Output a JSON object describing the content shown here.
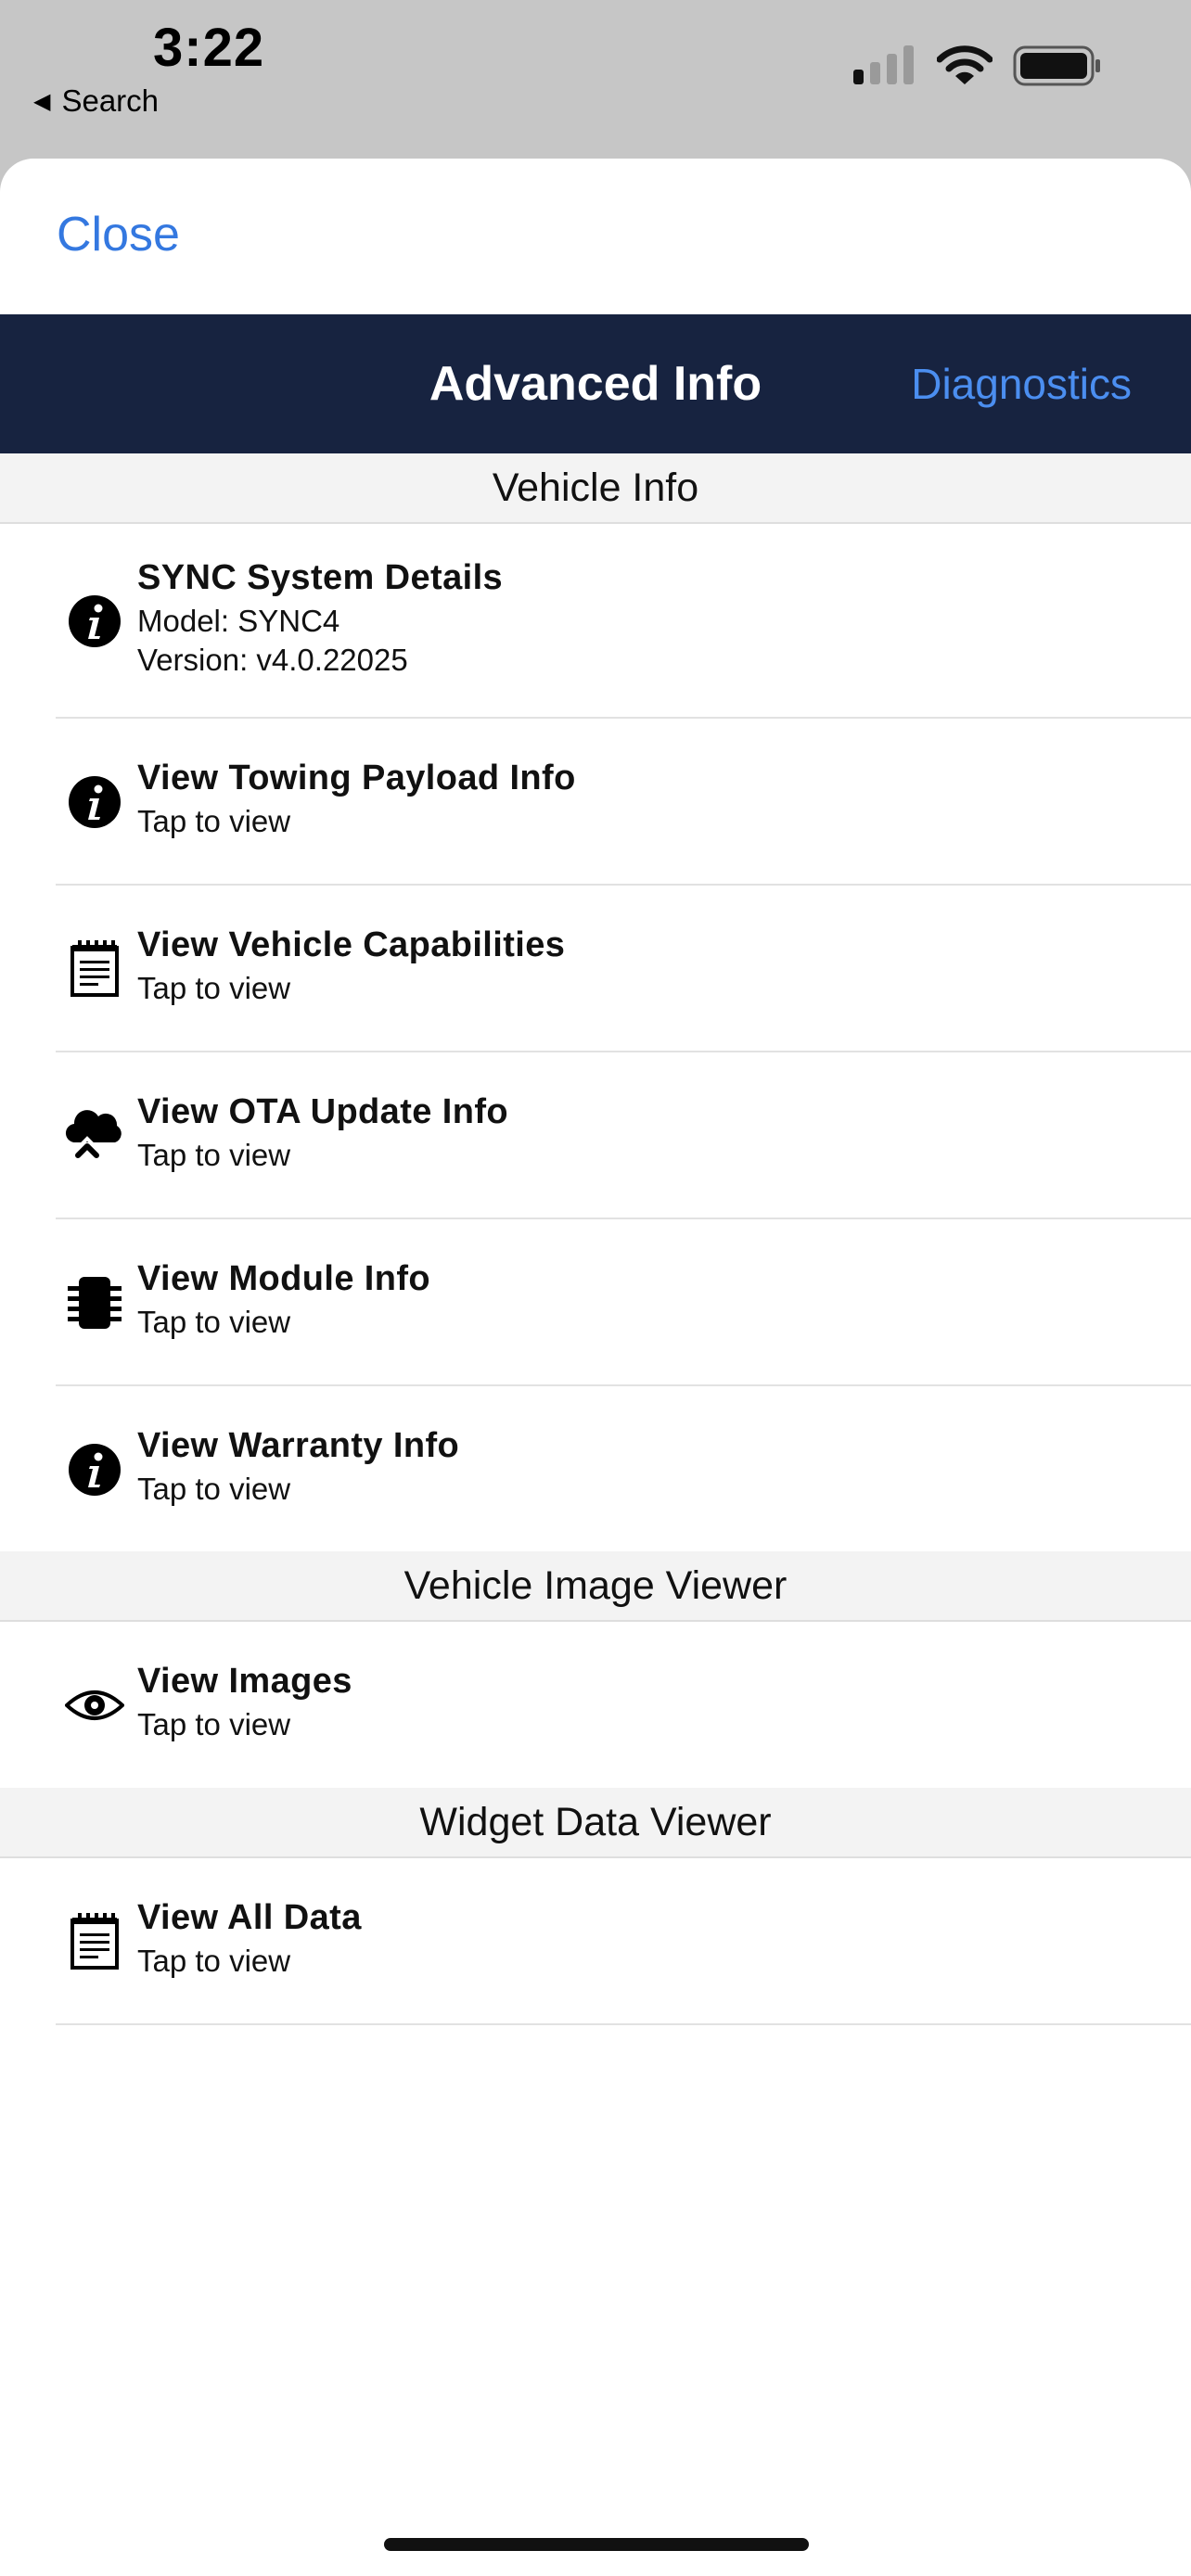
{
  "status_bar": {
    "time": "3:22",
    "back_label": "Search"
  },
  "sheet": {
    "close_label": "Close"
  },
  "nav": {
    "title": "Advanced Info",
    "right_label": "Diagnostics"
  },
  "sections": [
    {
      "header": "Vehicle Info",
      "rows": [
        {
          "icon": "info-icon",
          "title": "SYNC System Details",
          "lines": [
            "Model: SYNC4",
            "Version: v4.0.22025"
          ]
        },
        {
          "icon": "info-icon",
          "title": "View Towing Payload Info",
          "lines": [
            "Tap to view"
          ]
        },
        {
          "icon": "notepad-icon",
          "title": "View Vehicle Capabilities",
          "lines": [
            "Tap to view"
          ]
        },
        {
          "icon": "cloud-upload-icon",
          "title": "View OTA Update Info",
          "lines": [
            "Tap to view"
          ]
        },
        {
          "icon": "chip-icon",
          "title": "View Module Info",
          "lines": [
            "Tap to view"
          ]
        },
        {
          "icon": "info-icon",
          "title": "View Warranty Info",
          "lines": [
            "Tap to view"
          ]
        }
      ]
    },
    {
      "header": "Vehicle Image Viewer",
      "rows": [
        {
          "icon": "eye-icon",
          "title": "View Images",
          "lines": [
            "Tap to view"
          ]
        }
      ]
    },
    {
      "header": "Widget Data Viewer",
      "rows": [
        {
          "icon": "notepad-icon",
          "title": "View All Data",
          "lines": [
            "Tap to view"
          ]
        }
      ]
    }
  ]
}
